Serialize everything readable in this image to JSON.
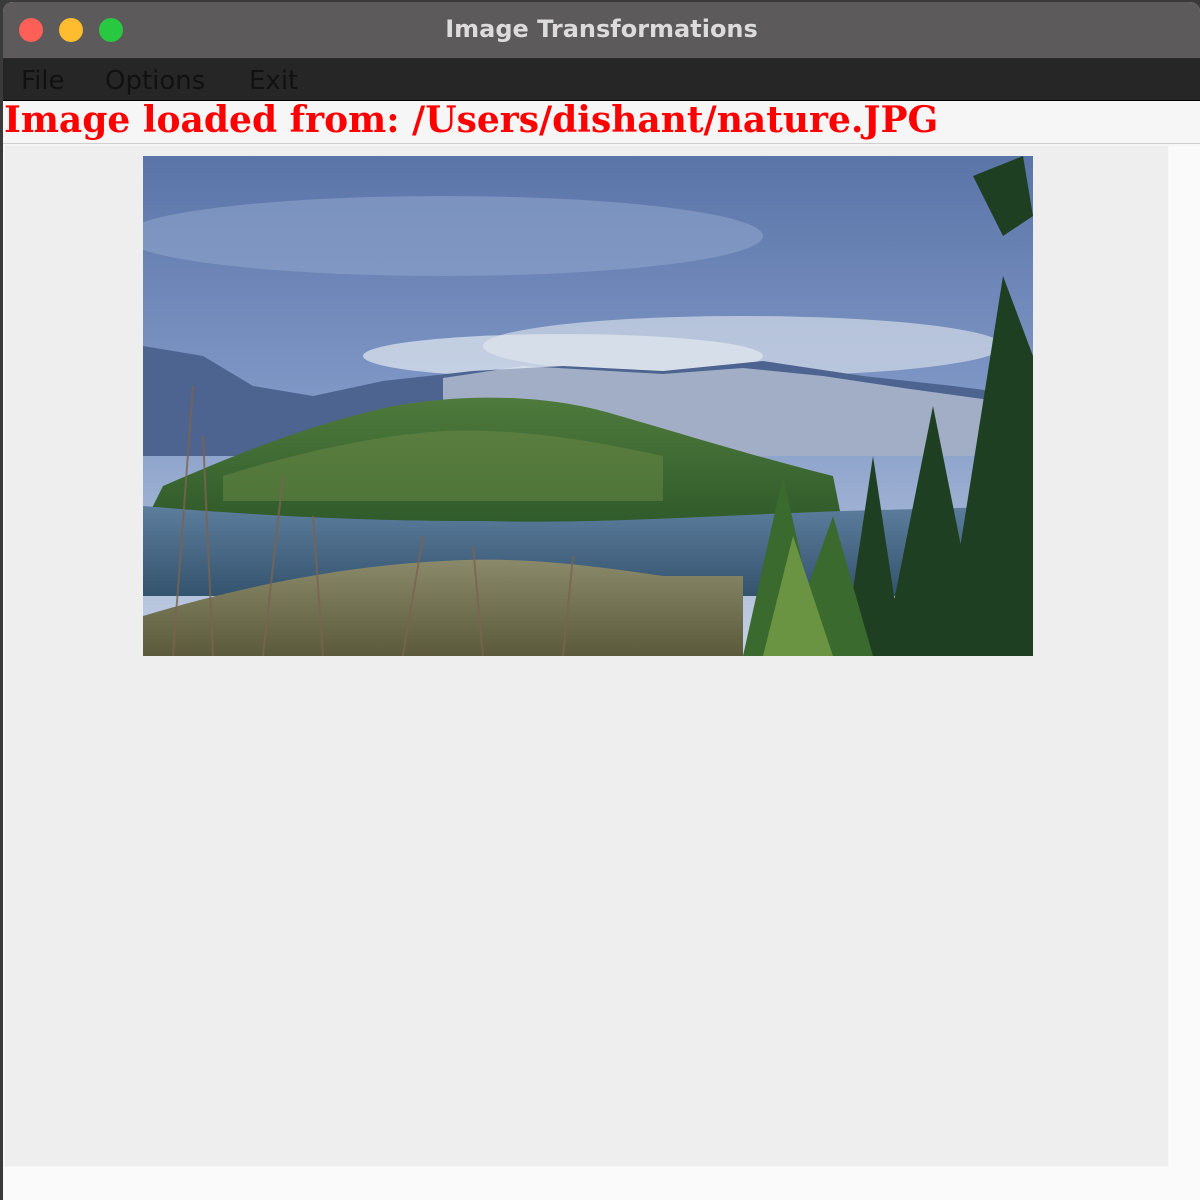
{
  "window": {
    "title": "Image Transformations"
  },
  "menubar": {
    "items": [
      {
        "label": "File"
      },
      {
        "label": "Options"
      },
      {
        "label": "Exit"
      }
    ]
  },
  "status": {
    "text": "Image loaded from: /Users/dishant/nature.JPG",
    "color": "#ff0000"
  },
  "image": {
    "description_icon": "landscape-photo"
  },
  "colors": {
    "titlebar": "#5d5a5b",
    "menubar": "#262626",
    "panel": "#eeeeee",
    "close": "#fe5f57",
    "minimize": "#febc2e",
    "zoom": "#28c840"
  }
}
